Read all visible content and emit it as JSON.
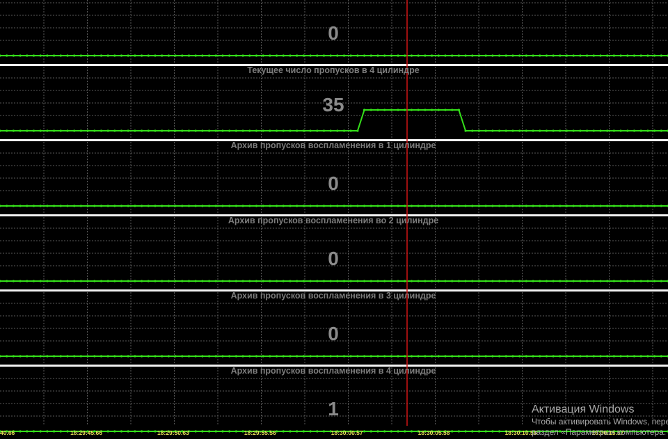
{
  "panels": [
    {
      "title": "",
      "value": "0",
      "values": [
        0,
        0,
        0,
        0,
        0,
        0,
        0,
        0,
        0,
        0,
        0,
        0,
        0,
        0,
        0,
        0,
        0,
        0,
        0,
        0,
        0,
        0,
        0,
        0,
        0,
        0,
        0,
        0,
        0,
        0,
        0,
        0,
        0,
        0,
        0,
        0,
        0,
        0,
        0,
        0,
        0,
        0,
        0,
        0,
        0,
        0,
        0,
        0,
        0,
        0,
        0,
        0,
        0,
        0,
        0,
        0,
        0,
        0,
        0,
        0,
        0,
        0,
        0,
        0,
        0,
        0,
        0,
        0,
        0,
        0,
        0,
        0,
        0,
        0,
        0,
        0,
        0,
        0,
        0,
        0,
        0,
        0,
        0,
        0,
        0,
        0,
        0,
        0,
        0,
        0,
        0,
        0,
        0,
        0,
        0,
        0,
        0,
        0,
        0,
        0
      ]
    },
    {
      "title": "Текущее число пропусков в 4 цилиндре",
      "value": "35",
      "values": [
        0,
        0,
        0,
        0,
        0,
        0,
        0,
        0,
        0,
        0,
        0,
        0,
        0,
        0,
        0,
        0,
        0,
        0,
        0,
        0,
        0,
        0,
        0,
        0,
        0,
        0,
        0,
        0,
        0,
        0,
        0,
        0,
        0,
        0,
        0,
        0,
        0,
        0,
        0,
        0,
        0,
        0,
        0,
        0,
        0,
        0,
        0,
        0,
        0,
        0,
        0,
        0,
        0,
        0,
        35,
        35,
        35,
        35,
        35,
        35,
        35,
        35,
        35,
        35,
        35,
        35,
        35,
        35,
        35,
        0,
        0,
        0,
        0,
        0,
        0,
        0,
        0,
        0,
        0,
        0,
        0,
        0,
        0,
        0,
        0,
        0,
        0,
        0,
        0,
        0,
        0,
        0,
        0,
        0,
        0,
        0,
        0,
        0,
        0,
        0
      ]
    },
    {
      "title": "Архив пропусков воспламенения в 1 цилиндре",
      "value": "0",
      "values": [
        0,
        0,
        0,
        0,
        0,
        0,
        0,
        0,
        0,
        0,
        0,
        0,
        0,
        0,
        0,
        0,
        0,
        0,
        0,
        0,
        0,
        0,
        0,
        0,
        0,
        0,
        0,
        0,
        0,
        0,
        0,
        0,
        0,
        0,
        0,
        0,
        0,
        0,
        0,
        0,
        0,
        0,
        0,
        0,
        0,
        0,
        0,
        0,
        0,
        0,
        0,
        0,
        0,
        0,
        0,
        0,
        0,
        0,
        0,
        0,
        0,
        0,
        0,
        0,
        0,
        0,
        0,
        0,
        0,
        0,
        0,
        0,
        0,
        0,
        0,
        0,
        0,
        0,
        0,
        0,
        0,
        0,
        0,
        0,
        0,
        0,
        0,
        0,
        0,
        0,
        0,
        0,
        0,
        0,
        0,
        0,
        0,
        0,
        0,
        0
      ]
    },
    {
      "title": "Архив пропусков воспламенения во 2 цилиндре",
      "value": "0",
      "values": [
        0,
        0,
        0,
        0,
        0,
        0,
        0,
        0,
        0,
        0,
        0,
        0,
        0,
        0,
        0,
        0,
        0,
        0,
        0,
        0,
        0,
        0,
        0,
        0,
        0,
        0,
        0,
        0,
        0,
        0,
        0,
        0,
        0,
        0,
        0,
        0,
        0,
        0,
        0,
        0,
        0,
        0,
        0,
        0,
        0,
        0,
        0,
        0,
        0,
        0,
        0,
        0,
        0,
        0,
        0,
        0,
        0,
        0,
        0,
        0,
        0,
        0,
        0,
        0,
        0,
        0,
        0,
        0,
        0,
        0,
        0,
        0,
        0,
        0,
        0,
        0,
        0,
        0,
        0,
        0,
        0,
        0,
        0,
        0,
        0,
        0,
        0,
        0,
        0,
        0,
        0,
        0,
        0,
        0,
        0,
        0,
        0,
        0,
        0,
        0
      ]
    },
    {
      "title": "Архив пропусков воспламенения в 3 цилиндре",
      "value": "0",
      "values": [
        0,
        0,
        0,
        0,
        0,
        0,
        0,
        0,
        0,
        0,
        0,
        0,
        0,
        0,
        0,
        0,
        0,
        0,
        0,
        0,
        0,
        0,
        0,
        0,
        0,
        0,
        0,
        0,
        0,
        0,
        0,
        0,
        0,
        0,
        0,
        0,
        0,
        0,
        0,
        0,
        0,
        0,
        0,
        0,
        0,
        0,
        0,
        0,
        0,
        0,
        0,
        0,
        0,
        0,
        0,
        0,
        0,
        0,
        0,
        0,
        0,
        0,
        0,
        0,
        0,
        0,
        0,
        0,
        0,
        0,
        0,
        0,
        0,
        0,
        0,
        0,
        0,
        0,
        0,
        0,
        0,
        0,
        0,
        0,
        0,
        0,
        0,
        0,
        0,
        0,
        0,
        0,
        0,
        0,
        0,
        0,
        0,
        0,
        0,
        0
      ]
    },
    {
      "title": "Архив пропусков воспламенения в 4 цилиндре",
      "value": "1",
      "values": [
        0,
        0,
        0,
        0,
        0,
        0,
        0,
        0,
        0,
        0,
        0,
        0,
        0,
        0,
        0,
        0,
        0,
        0,
        0,
        0,
        0,
        0,
        0,
        0,
        0,
        0,
        0,
        0,
        0,
        0,
        0,
        0,
        0,
        0,
        0,
        0,
        0,
        0,
        0,
        0,
        0,
        0,
        0,
        0,
        0,
        0,
        0,
        0,
        0,
        0,
        0,
        0,
        0,
        0,
        0,
        0,
        0,
        0,
        0,
        0,
        0,
        0,
        0,
        0,
        0,
        0,
        0,
        0,
        0,
        0,
        0,
        0,
        0,
        0,
        0,
        0,
        0,
        0,
        0,
        0,
        0,
        0,
        0,
        0,
        0,
        0,
        0,
        0,
        0,
        0,
        0,
        0,
        0,
        0,
        0,
        0,
        0,
        0,
        0,
        0
      ]
    }
  ],
  "time_axis": {
    "labels": [
      "40.66",
      "18:29:45.66",
      "18:29:50.63",
      "18:29:55.56",
      "18:30:00.57",
      "18:30:05.58",
      "18:30:10.58",
      "18:30:15.57"
    ]
  },
  "cursor": {
    "time": "18:30:04.5"
  },
  "colors": {
    "background": "#000000",
    "grid": "#5a5a5a",
    "trace": "#35e01a",
    "separator": "#f2f2f2",
    "cursor": "#d11414",
    "title": "#7d7d7d",
    "value": "#8a8a8a",
    "time_label": "#e8e05a"
  },
  "watermark": {
    "title": "Активация Windows",
    "text": "Чтобы активировать Windows, перейдите в раздел «Параметры» компьютера."
  }
}
